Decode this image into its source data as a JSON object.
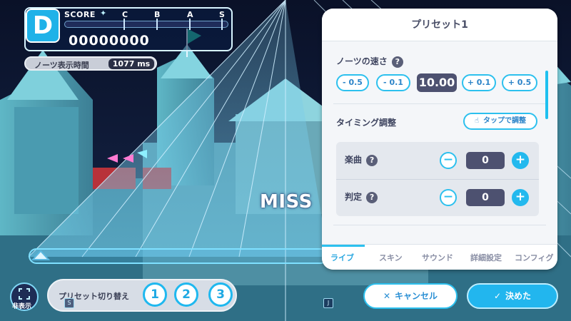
{
  "hud": {
    "rank_badge": "D",
    "score_label": "SCORE",
    "rank_letters": [
      "C",
      "B",
      "A",
      "S"
    ],
    "score": "00000000",
    "note_time_label": "ノーツ表示時間",
    "note_time_value": "1077 ms"
  },
  "lane": {
    "judgement": "MISS"
  },
  "panel": {
    "title": "プリセット1",
    "note_speed": {
      "title": "ノーツの速さ",
      "help": "?",
      "buttons": [
        "- 0.5",
        "- 0.1",
        "+ 0.1",
        "+ 0.5"
      ],
      "value": "10.00"
    },
    "timing": {
      "title": "タイミング調整",
      "tap_adjust": "タップで調整",
      "rows": [
        {
          "label": "楽曲",
          "help": "?",
          "value": "0",
          "minus": "−",
          "plus": "+"
        },
        {
          "label": "判定",
          "help": "?",
          "value": "0",
          "minus": "−",
          "plus": "+"
        }
      ]
    },
    "tabs": [
      "ライブ",
      "スキン",
      "サウンド",
      "詳細設定",
      "コンフィグ"
    ]
  },
  "bottom": {
    "hide_label": "非表示",
    "preset_switch_label": "プリセット切り替え",
    "presets": [
      "1",
      "2",
      "3"
    ],
    "lane_keys": [
      "S",
      "J"
    ],
    "cancel_label": "キャンセル",
    "ok_label": "決めた"
  },
  "colors": {
    "accent": "#2cc0ee",
    "panel_bg": "#f4f6f9",
    "value_box": "#4d5170",
    "night_sky": "#0b1430"
  }
}
